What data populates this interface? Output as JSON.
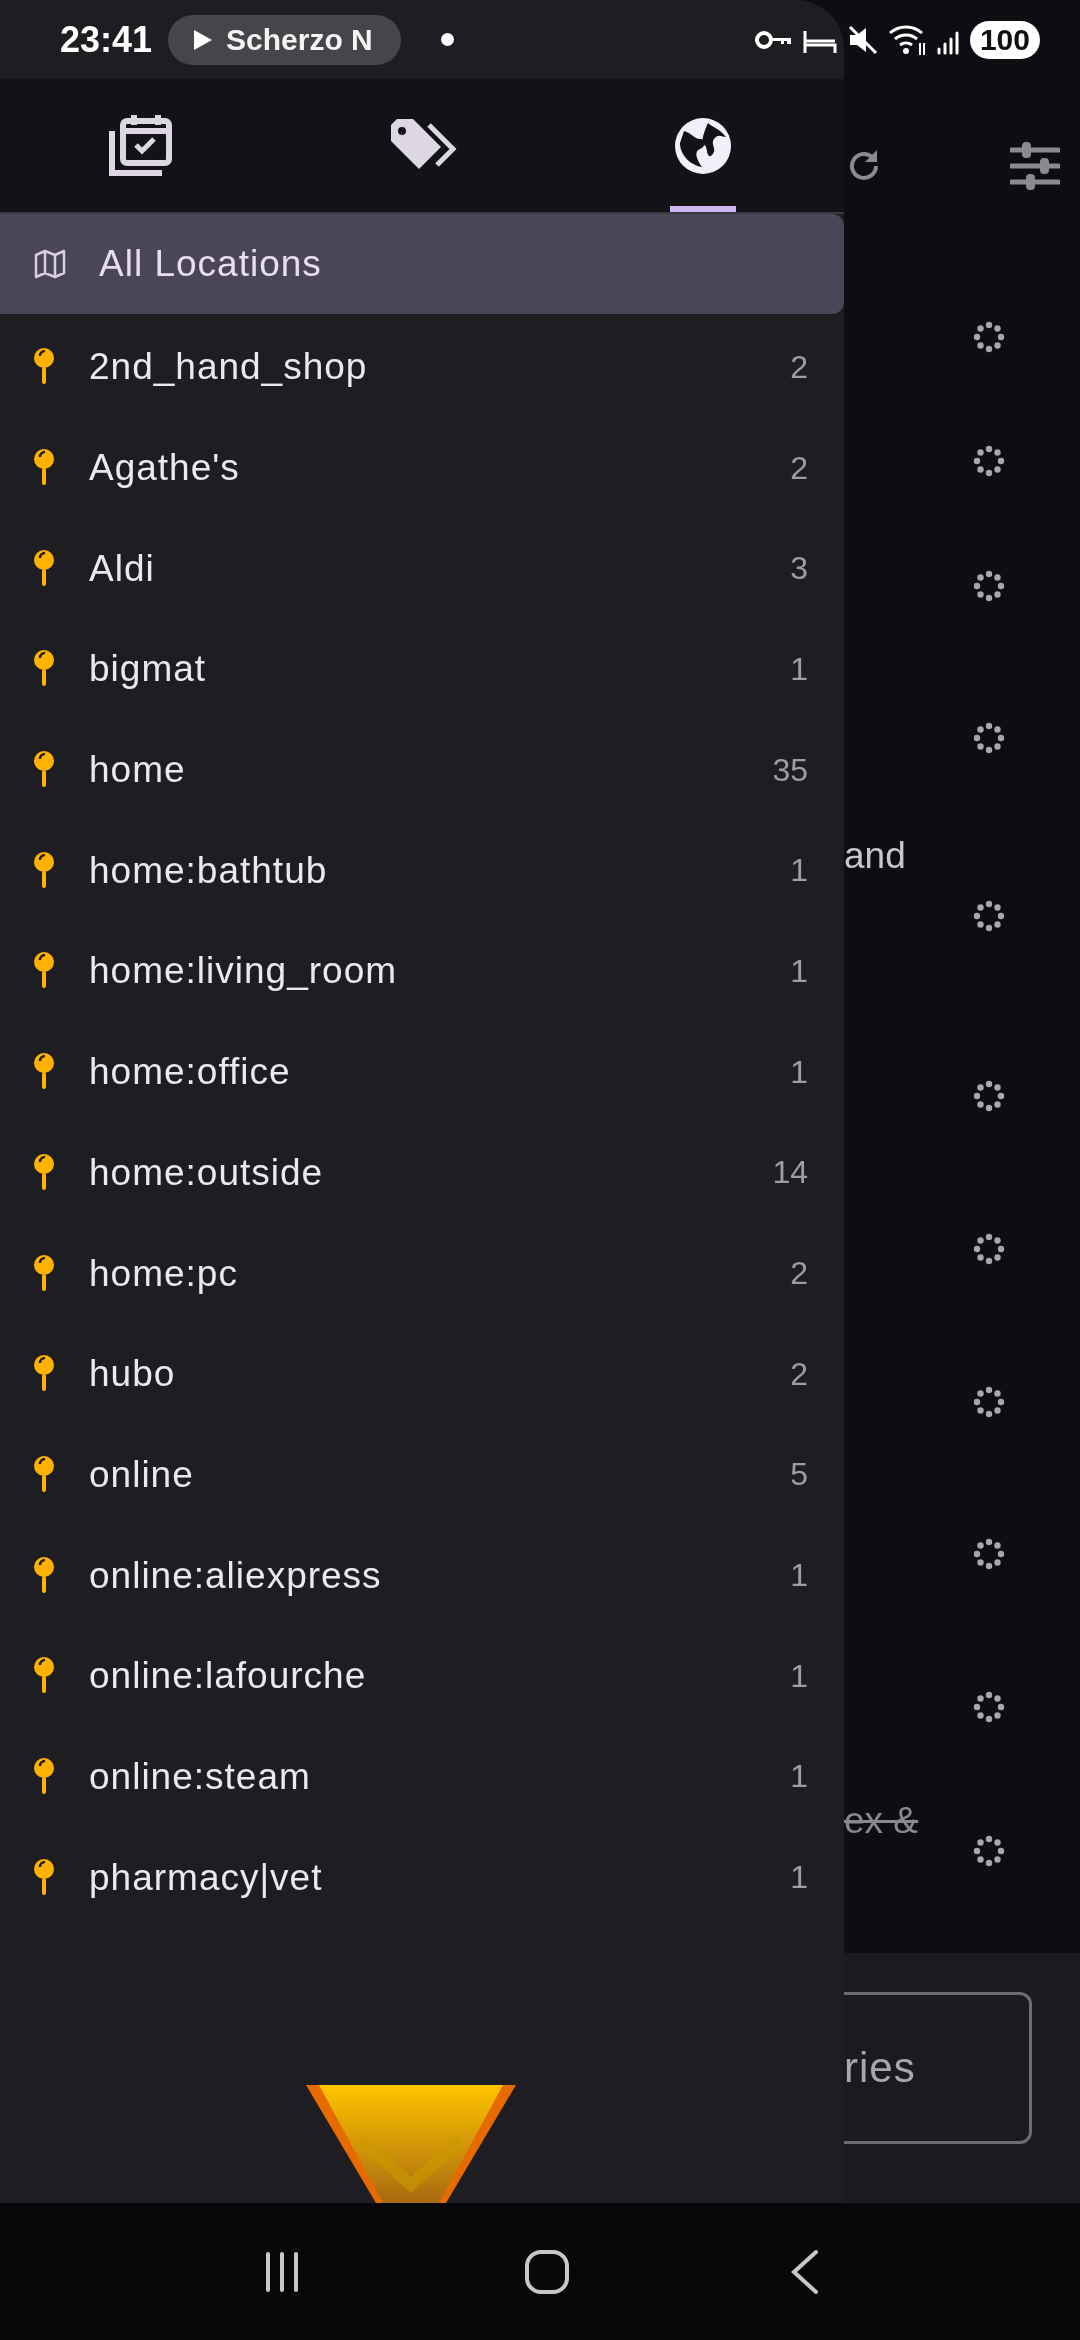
{
  "status_bar": {
    "time": "23:41",
    "media_title": "Scherzo N",
    "battery": "100"
  },
  "drawer": {
    "tabs": [
      {
        "kind": "calendar",
        "selected": false
      },
      {
        "kind": "tags",
        "selected": false
      },
      {
        "kind": "globe",
        "selected": true
      }
    ],
    "all_locations": {
      "label": "All Locations",
      "selected": true
    },
    "locations": [
      {
        "name": "2nd_hand_shop",
        "count": "2"
      },
      {
        "name": "Agathe's",
        "count": "2"
      },
      {
        "name": "Aldi",
        "count": "3"
      },
      {
        "name": "bigmat",
        "count": "1"
      },
      {
        "name": "home",
        "count": "35"
      },
      {
        "name": "home:bathtub",
        "count": "1"
      },
      {
        "name": "home:living_room",
        "count": "1"
      },
      {
        "name": "home:office",
        "count": "1"
      },
      {
        "name": "home:outside",
        "count": "14"
      },
      {
        "name": "home:pc",
        "count": "2"
      },
      {
        "name": "hubo",
        "count": "2"
      },
      {
        "name": "online",
        "count": "5"
      },
      {
        "name": "online:aliexpress",
        "count": "1"
      },
      {
        "name": "online:lafourche",
        "count": "1"
      },
      {
        "name": "online:steam",
        "count": "1"
      },
      {
        "name": "pharmacy|vet",
        "count": "1"
      }
    ]
  },
  "background": {
    "texts": [
      {
        "text": "and",
        "done": false
      },
      {
        "text": "ex &",
        "done": true
      }
    ],
    "button": "ries"
  }
}
